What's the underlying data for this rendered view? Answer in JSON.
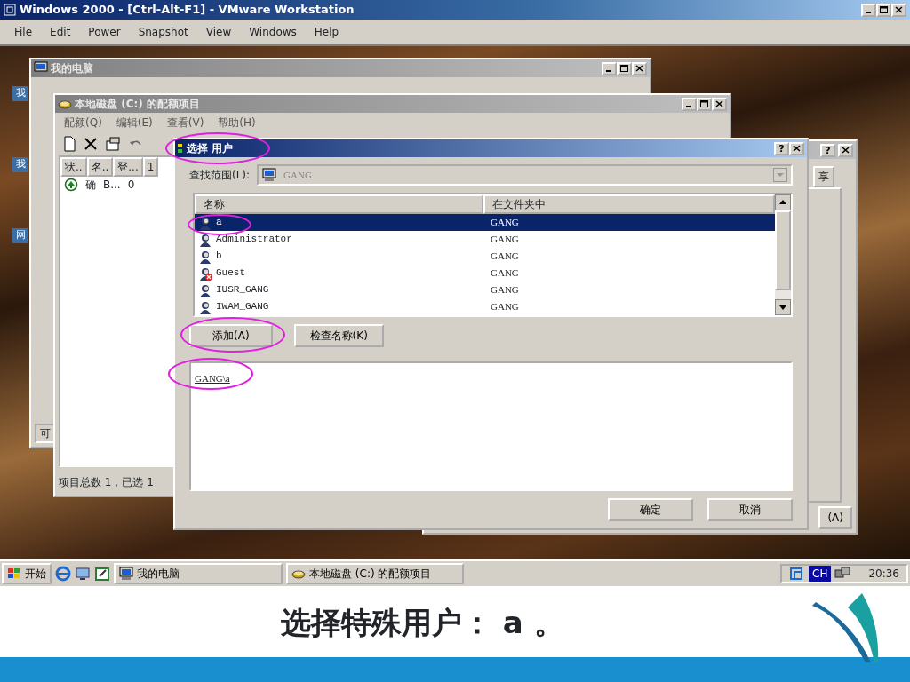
{
  "vmware": {
    "title": "Windows 2000 - [Ctrl-Alt-F1] - VMware Workstation",
    "menu": [
      "File",
      "Edit",
      "Power",
      "Snapshot",
      "View",
      "Windows",
      "Help"
    ]
  },
  "desktop_icons": [
    {
      "label": "我"
    },
    {
      "label": "我"
    },
    {
      "label": "网"
    }
  ],
  "my_computer": {
    "title": "我的电脑",
    "status": "可"
  },
  "quota_window": {
    "title": "本地磁盘 (C:) 的配额项目",
    "menu": [
      "配额(Q)",
      "编辑(E)",
      "查看(V)",
      "帮助(H)"
    ],
    "columns": [
      "状..",
      "名..",
      "登...",
      "1"
    ],
    "rows": [
      {
        "cells": [
          "确",
          "B...",
          "0"
        ]
      }
    ],
    "status": "项目总数 1，已选 1"
  },
  "properties_window": {
    "help_label": "?",
    "tab": "享",
    "button": "(A)"
  },
  "dialog": {
    "title": "选择 用户",
    "title_circled": true,
    "help_label": "?",
    "look_in_label": "查找范围(L):",
    "look_in_value": "GANG",
    "columns": [
      "名称",
      "在文件夹中"
    ],
    "rows": [
      {
        "name": "a",
        "folder": "GANG",
        "selected": true,
        "disabled": false,
        "circled": true
      },
      {
        "name": "Administrator",
        "folder": "GANG",
        "selected": false,
        "disabled": false,
        "circled": false
      },
      {
        "name": "b",
        "folder": "GANG",
        "selected": false,
        "disabled": false,
        "circled": false
      },
      {
        "name": "Guest",
        "folder": "GANG",
        "selected": false,
        "disabled": true,
        "circled": false
      },
      {
        "name": "IUSR_GANG",
        "folder": "GANG",
        "selected": false,
        "disabled": false,
        "circled": false
      },
      {
        "name": "IWAM_GANG",
        "folder": "GANG",
        "selected": false,
        "disabled": false,
        "circled": false
      }
    ],
    "add_button": {
      "label": "添加(A)",
      "circled": true
    },
    "check_button": "检查名称(K)",
    "selected_users": [
      {
        "text": "GANG\\a",
        "circled": true
      }
    ],
    "ok_button": "确定",
    "cancel_button": "取消"
  },
  "taskbar": {
    "start": "开始",
    "tasks": [
      {
        "label": "我的电脑",
        "kind": "computer"
      },
      {
        "label": "本地磁盘 (C:) 的配额项目",
        "kind": "disk"
      }
    ],
    "language": "CH",
    "clock": "20:36"
  },
  "caption": "选择特殊用户： a 。"
}
